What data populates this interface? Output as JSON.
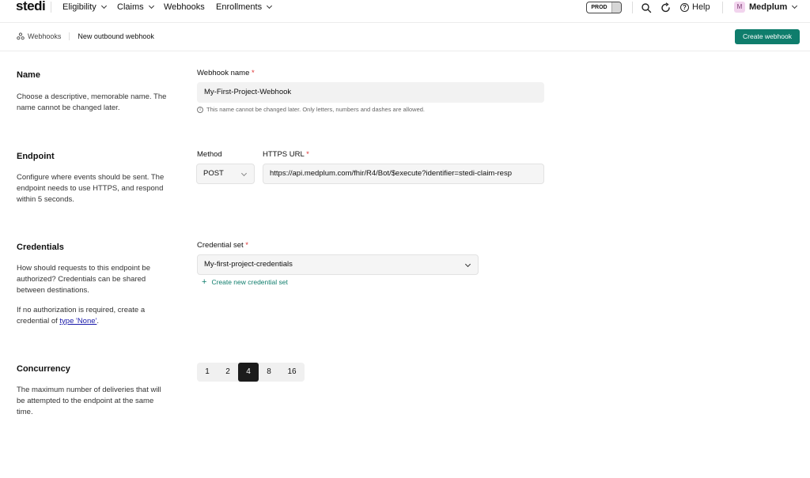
{
  "nav": {
    "logo": "stedi",
    "items": [
      {
        "label": "Eligibility",
        "has_menu": true
      },
      {
        "label": "Claims",
        "has_menu": true
      },
      {
        "label": "Webhooks",
        "has_menu": false
      },
      {
        "label": "Enrollments",
        "has_menu": true
      }
    ],
    "environment": "PROD",
    "help_label": "Help",
    "org_initial": "M",
    "org_name": "Medplum"
  },
  "breadcrumb": {
    "parent": "Webhooks",
    "current": "New outbound webhook"
  },
  "header": {
    "create_button": "Create webhook"
  },
  "sections": {
    "name": {
      "title": "Name",
      "description": "Choose a descriptive, memorable name. The name cannot be changed later.",
      "field_label": "Webhook name",
      "required_mark": "*",
      "value": "My-First-Project-Webhook",
      "hint": "This name cannot be changed later. Only letters, numbers and dashes are allowed."
    },
    "endpoint": {
      "title": "Endpoint",
      "description": "Configure where events should be sent. The endpoint needs to use HTTPS, and respond within 5 seconds.",
      "method_label": "Method",
      "method_value": "POST",
      "url_label": "HTTPS URL",
      "required_mark": "*",
      "url_value": "https://api.medplum.com/fhir/R4/Bot/$execute?identifier=stedi-claim-resp"
    },
    "credentials": {
      "title": "Credentials",
      "description": "How should requests to this endpoint be authorized? Credentials can be shared between destinations.",
      "note_prefix": "If no authorization is required, create a credential of ",
      "note_link": "type 'None'",
      "note_suffix": ".",
      "field_label": "Credential set",
      "required_mark": "*",
      "value": "My-first-project-credentials",
      "add_link": "Create new credential set"
    },
    "concurrency": {
      "title": "Concurrency",
      "description": "The maximum number of deliveries that will be attempted to the endpoint at the same time.",
      "options": [
        "1",
        "2",
        "4",
        "8",
        "16"
      ],
      "selected": "4"
    }
  },
  "colors": {
    "accent": "#0f7d6c",
    "required": "#dd3333",
    "selected_segment": "#1b1b1b"
  }
}
